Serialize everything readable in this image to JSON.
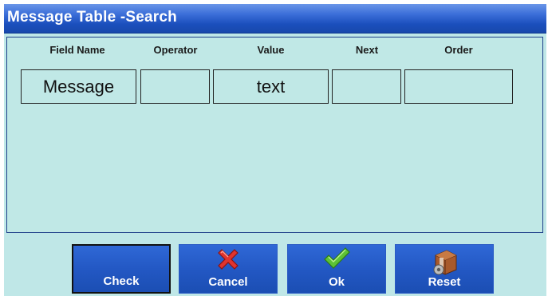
{
  "window": {
    "title": "Message Table -Search"
  },
  "columns": [
    "Field Name",
    "Operator",
    "Value",
    "Next",
    "Order"
  ],
  "row": {
    "field_name": "Message",
    "operator": "",
    "value": "text",
    "next": "",
    "order": ""
  },
  "buttons": {
    "check": {
      "label": "Check",
      "icon": "none"
    },
    "cancel": {
      "label": "Cancel",
      "icon": "red-x-icon"
    },
    "ok": {
      "label": "Ok",
      "icon": "green-checkmark-icon"
    },
    "reset": {
      "label": "Reset",
      "icon": "reset-box-gear-icon"
    }
  },
  "colors": {
    "title_bar": "#2a5fcf",
    "background": "#bfe7e7",
    "button": "#2358c4",
    "cancel_icon": "#e0342f",
    "ok_icon": "#5dc236"
  }
}
